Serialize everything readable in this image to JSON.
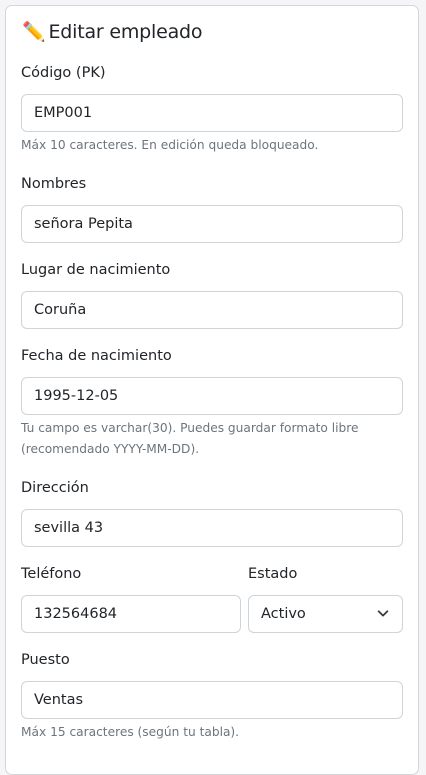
{
  "form": {
    "title_icon": "✏️",
    "title": "Editar empleado",
    "codigo": {
      "label": "Código (PK)",
      "value": "EMP001",
      "help": "Máx 10 caracteres. En edición queda bloqueado."
    },
    "nombres": {
      "label": "Nombres",
      "value": "señora Pepita"
    },
    "lugar": {
      "label": "Lugar de nacimiento",
      "value": "Coruña"
    },
    "fecha": {
      "label": "Fecha de nacimiento",
      "value": "1995-12-05",
      "help_line1": "Tu campo es varchar(30). Puedes guardar formato libre",
      "help_line2": "(recomendado YYYY-MM-DD)."
    },
    "direccion": {
      "label": "Dirección",
      "value": "sevilla 43"
    },
    "telefono": {
      "label": "Teléfono",
      "value": "132564684"
    },
    "estado": {
      "label": "Estado",
      "value": "Activo",
      "icon": "chevron-down-icon"
    },
    "puesto": {
      "label": "Puesto",
      "value": "Ventas",
      "help": "Máx 15 caracteres (según tu tabla)."
    }
  }
}
